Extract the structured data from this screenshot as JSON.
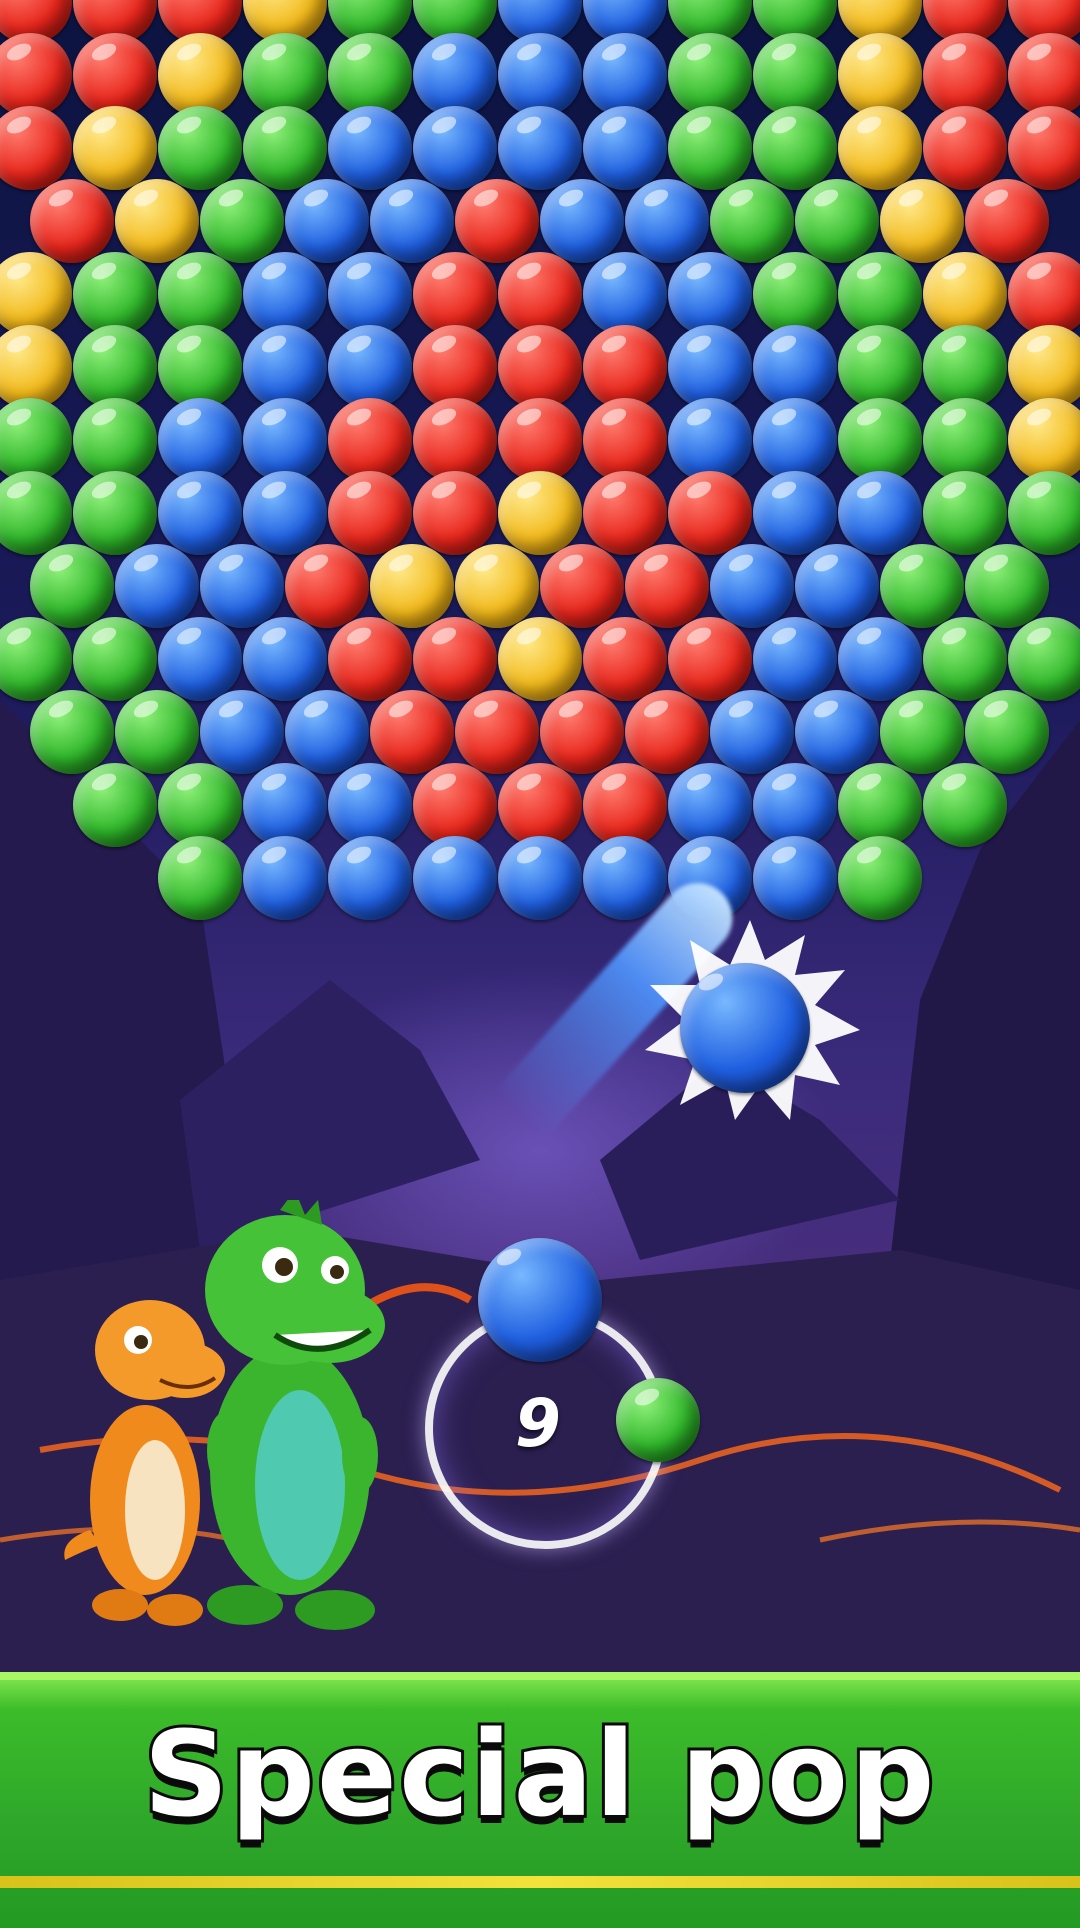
{
  "game": {
    "shots_remaining": "9",
    "banner_title": "Special pop"
  },
  "colors": {
    "red": "#e8261c",
    "yellow": "#f2b91a",
    "green": "#2fb62a",
    "blue": "#1f5fe0",
    "banner_green": "#2ea62a"
  },
  "board": {
    "rows": [
      "rrryggbbggyrr",
      "rryggbbbggyrr",
      "ryggbbbbggyrr",
      "rygbbrbbggyr",
      "yggbbrrbbggyr",
      "yggbbrrrbbggy",
      "ggbbrrrrbbggy",
      "ggbbrryrrbbgg",
      "gbbryyrrbbgg",
      "ggbbrryrrbbgg",
      "ggbbrrrrbbgg",
      "ggbbrrrbbgg",
      "gbbbbbbbg"
    ]
  },
  "launcher": {
    "current_bubble": "blue",
    "next_bubble": "green",
    "fired_bubble": "blue"
  }
}
